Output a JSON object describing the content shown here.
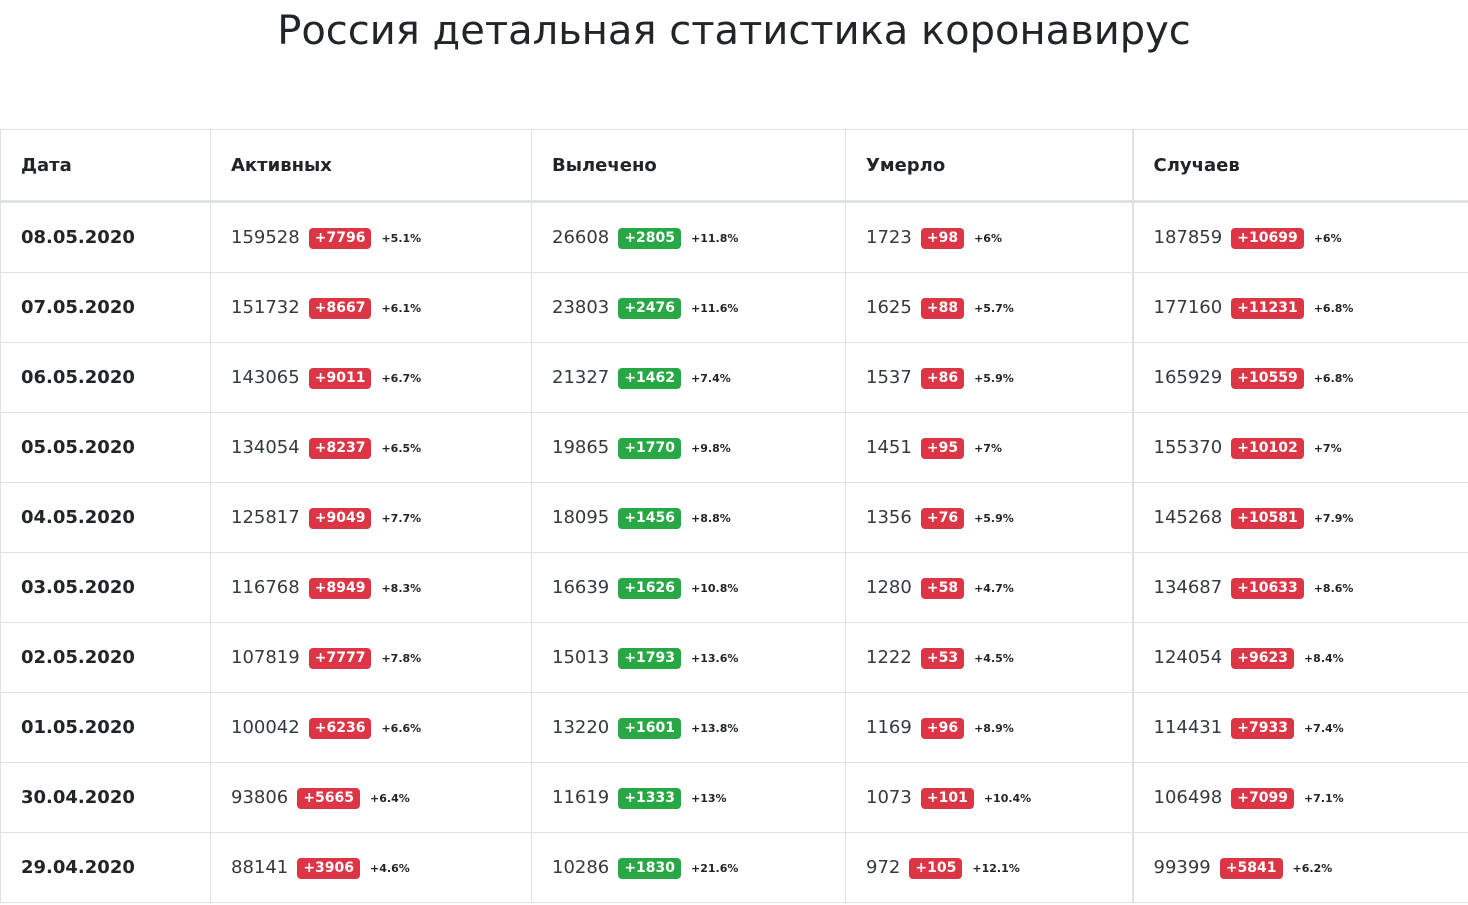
{
  "page": {
    "title": "Россия детальная статистика коронавирус"
  },
  "colors": {
    "increase_bad": "#dc3545",
    "increase_good": "#28a745"
  },
  "table": {
    "headers": [
      "Дата",
      "Активных",
      "Вылечено",
      "Умерло",
      "Случаев"
    ],
    "rows": [
      {
        "date": "08.05.2020",
        "active": {
          "value": "159528",
          "delta": "+7796",
          "pct": "+5.1%"
        },
        "recovered": {
          "value": "26608",
          "delta": "+2805",
          "pct": "+11.8%"
        },
        "deaths": {
          "value": "1723",
          "delta": "+98",
          "pct": "+6%"
        },
        "cases": {
          "value": "187859",
          "delta": "+10699",
          "pct": "+6%"
        }
      },
      {
        "date": "07.05.2020",
        "active": {
          "value": "151732",
          "delta": "+8667",
          "pct": "+6.1%"
        },
        "recovered": {
          "value": "23803",
          "delta": "+2476",
          "pct": "+11.6%"
        },
        "deaths": {
          "value": "1625",
          "delta": "+88",
          "pct": "+5.7%"
        },
        "cases": {
          "value": "177160",
          "delta": "+11231",
          "pct": "+6.8%"
        }
      },
      {
        "date": "06.05.2020",
        "active": {
          "value": "143065",
          "delta": "+9011",
          "pct": "+6.7%"
        },
        "recovered": {
          "value": "21327",
          "delta": "+1462",
          "pct": "+7.4%"
        },
        "deaths": {
          "value": "1537",
          "delta": "+86",
          "pct": "+5.9%"
        },
        "cases": {
          "value": "165929",
          "delta": "+10559",
          "pct": "+6.8%"
        }
      },
      {
        "date": "05.05.2020",
        "active": {
          "value": "134054",
          "delta": "+8237",
          "pct": "+6.5%"
        },
        "recovered": {
          "value": "19865",
          "delta": "+1770",
          "pct": "+9.8%"
        },
        "deaths": {
          "value": "1451",
          "delta": "+95",
          "pct": "+7%"
        },
        "cases": {
          "value": "155370",
          "delta": "+10102",
          "pct": "+7%"
        }
      },
      {
        "date": "04.05.2020",
        "active": {
          "value": "125817",
          "delta": "+9049",
          "pct": "+7.7%"
        },
        "recovered": {
          "value": "18095",
          "delta": "+1456",
          "pct": "+8.8%"
        },
        "deaths": {
          "value": "1356",
          "delta": "+76",
          "pct": "+5.9%"
        },
        "cases": {
          "value": "145268",
          "delta": "+10581",
          "pct": "+7.9%"
        }
      },
      {
        "date": "03.05.2020",
        "active": {
          "value": "116768",
          "delta": "+8949",
          "pct": "+8.3%"
        },
        "recovered": {
          "value": "16639",
          "delta": "+1626",
          "pct": "+10.8%"
        },
        "deaths": {
          "value": "1280",
          "delta": "+58",
          "pct": "+4.7%"
        },
        "cases": {
          "value": "134687",
          "delta": "+10633",
          "pct": "+8.6%"
        }
      },
      {
        "date": "02.05.2020",
        "active": {
          "value": "107819",
          "delta": "+7777",
          "pct": "+7.8%"
        },
        "recovered": {
          "value": "15013",
          "delta": "+1793",
          "pct": "+13.6%"
        },
        "deaths": {
          "value": "1222",
          "delta": "+53",
          "pct": "+4.5%"
        },
        "cases": {
          "value": "124054",
          "delta": "+9623",
          "pct": "+8.4%"
        }
      },
      {
        "date": "01.05.2020",
        "active": {
          "value": "100042",
          "delta": "+6236",
          "pct": "+6.6%"
        },
        "recovered": {
          "value": "13220",
          "delta": "+1601",
          "pct": "+13.8%"
        },
        "deaths": {
          "value": "1169",
          "delta": "+96",
          "pct": "+8.9%"
        },
        "cases": {
          "value": "114431",
          "delta": "+7933",
          "pct": "+7.4%"
        }
      },
      {
        "date": "30.04.2020",
        "active": {
          "value": "93806",
          "delta": "+5665",
          "pct": "+6.4%"
        },
        "recovered": {
          "value": "11619",
          "delta": "+1333",
          "pct": "+13%"
        },
        "deaths": {
          "value": "1073",
          "delta": "+101",
          "pct": "+10.4%"
        },
        "cases": {
          "value": "106498",
          "delta": "+7099",
          "pct": "+7.1%"
        }
      },
      {
        "date": "29.04.2020",
        "active": {
          "value": "88141",
          "delta": "+3906",
          "pct": "+4.6%"
        },
        "recovered": {
          "value": "10286",
          "delta": "+1830",
          "pct": "+21.6%"
        },
        "deaths": {
          "value": "972",
          "delta": "+105",
          "pct": "+12.1%"
        },
        "cases": {
          "value": "99399",
          "delta": "+5841",
          "pct": "+6.2%"
        }
      }
    ]
  }
}
